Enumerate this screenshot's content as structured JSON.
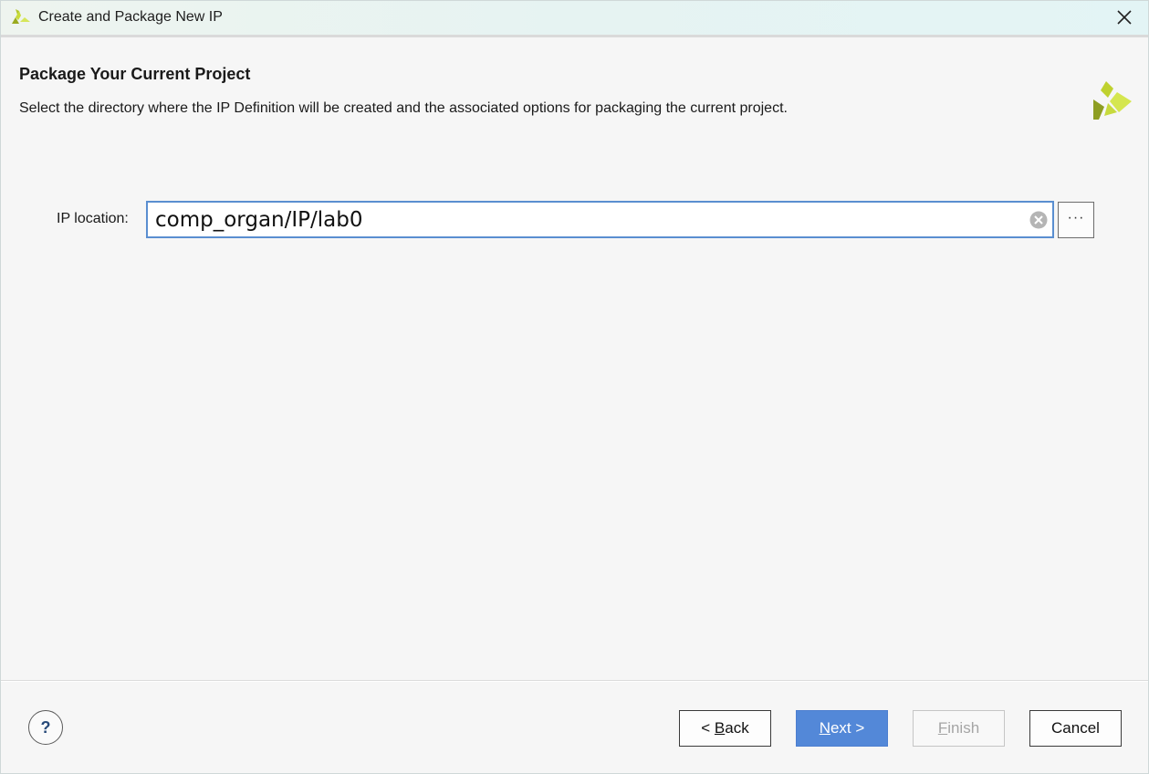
{
  "window": {
    "title": "Create and Package New IP",
    "logo_icon": "xilinx-logo-icon",
    "close_icon": "close-icon"
  },
  "header": {
    "title": "Package Your Current Project",
    "description": "Select the directory where the IP Definition will be created and the associated options for packaging the current project.",
    "logo_icon": "xilinx-logo-icon"
  },
  "form": {
    "ip_location_label": "IP location:",
    "ip_location_value": "comp_organ/IP/lab0",
    "clear_icon": "clear-circle-icon",
    "browse_label": "···"
  },
  "footer": {
    "help_label": "?",
    "back_prefix": "< ",
    "back_mnemonic": "B",
    "back_rest": "ack",
    "next_mnemonic": "N",
    "next_rest": "ext >",
    "finish_mnemonic": "F",
    "finish_rest": "inish",
    "cancel_label": "Cancel"
  },
  "colors": {
    "accent": "#5388d8",
    "input_border": "#5a8ed0",
    "logo_dark": "#8a9a1f",
    "logo_light": "#c8dc3a"
  }
}
